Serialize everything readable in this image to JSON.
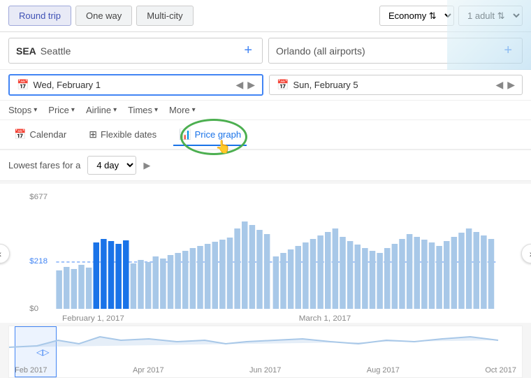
{
  "topBar": {
    "roundTrip": "Round trip",
    "oneWay": "One way",
    "multiCity": "Multi-city",
    "classLabel": "Economy",
    "adultsLabel": "1 adult"
  },
  "searchRow": {
    "originCode": "SEA",
    "originCity": "Seattle",
    "addOriginLabel": "+",
    "destination": "Orlando (all airports)",
    "addDestLabel": "+"
  },
  "dateRow": {
    "departureFull": "Wed, February 1",
    "returnFull": "Sun, February 5"
  },
  "filters": {
    "stops": "Stops",
    "price": "Price",
    "airline": "Airline",
    "times": "Times",
    "more": "More"
  },
  "viewTabs": {
    "calendar": "Calendar",
    "flexibleDates": "Flexible dates",
    "priceGraph": "Price graph"
  },
  "lowestFares": {
    "label": "Lowest fares for a",
    "duration": "4 day"
  },
  "chart": {
    "priceHigh": "$677",
    "priceMid": "$218",
    "priceLow": "$0",
    "label1": "February 1, 2017",
    "label2": "March 1, 2017"
  },
  "miniChart": {
    "labels": [
      "Feb 2017",
      "Apr 2017",
      "Jun 2017",
      "Aug 2017",
      "Oct 2017"
    ]
  },
  "navButtons": {
    "left": "‹",
    "right": "›"
  }
}
